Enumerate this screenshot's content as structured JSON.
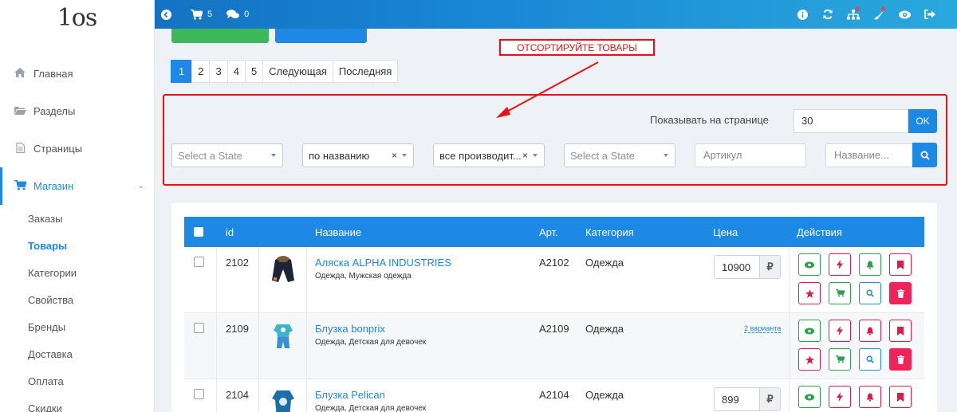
{
  "logo": "1os",
  "topbar": {
    "cart_count": "5",
    "comments_count": "0"
  },
  "sidebar": {
    "items": [
      {
        "label": "Главная",
        "icon": "home-icon"
      },
      {
        "label": "Разделы",
        "icon": "folder-icon"
      },
      {
        "label": "Страницы",
        "icon": "file-icon"
      },
      {
        "label": "Магазин",
        "icon": "cart-icon"
      }
    ],
    "shop_submenu": [
      "Заказы",
      "Товары",
      "Категории",
      "Свойства",
      "Бренды",
      "Доставка",
      "Оплата",
      "Скидки"
    ]
  },
  "pagination": {
    "pages": [
      "1",
      "2",
      "3",
      "4",
      "5"
    ],
    "next": "Следующая",
    "last": "Последняя"
  },
  "annotation": "ОТСОРТИРУЙТЕ ТОВАРЫ",
  "filters": {
    "per_page_label": "Показывать на странице",
    "per_page_value": "30",
    "ok": "OK",
    "state1": "Select a State",
    "sort": "по названию",
    "manufacturer": "все производит...",
    "state2": "Select a State",
    "article_placeholder": "Артикул",
    "name_placeholder": "Название..."
  },
  "table": {
    "headers": {
      "id": "id",
      "name": "Название",
      "art": "Арт.",
      "category": "Категория",
      "price": "Цена",
      "actions": "Действия"
    },
    "rows": [
      {
        "id": "2102",
        "name": "Аляска ALPHA INDUSTRIES",
        "sub": "Одежда, Мужская одежда",
        "art": "A2102",
        "category": "Одежда",
        "price": "10900"
      },
      {
        "id": "2109",
        "name": "Блузка bonprix",
        "sub": "Одежда, Детская для девочек",
        "art": "A2109",
        "category": "Одежда",
        "price_variants": "2 варианта"
      },
      {
        "id": "2104",
        "name": "Блузка Pelican",
        "sub": "Одежда, Детская для девочек",
        "art": "A2104",
        "category": "Одежда",
        "price": "899"
      }
    ],
    "currency": "₽"
  },
  "colors": {
    "accent": "#1e88e5",
    "green": "#2aa14b",
    "red": "#e1184a",
    "annotation": "#ee1111"
  }
}
